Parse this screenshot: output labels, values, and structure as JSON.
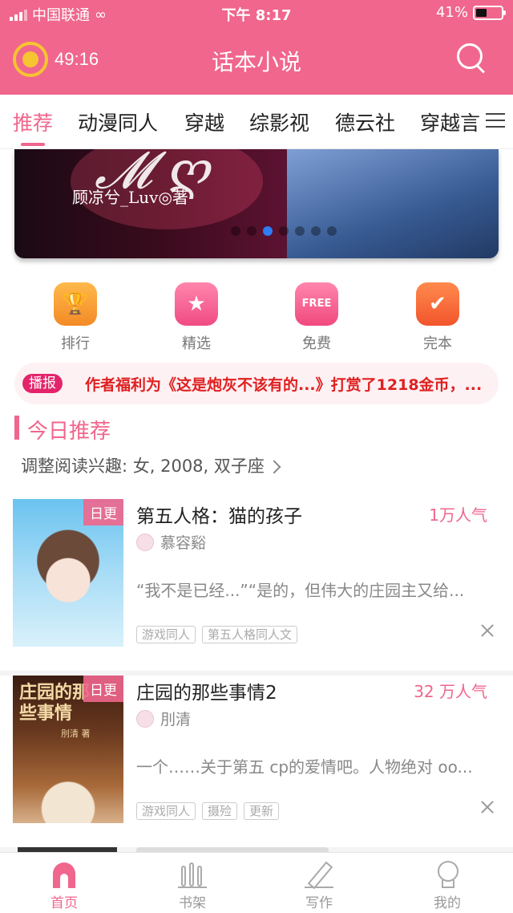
{
  "status_bar": {
    "carrier": "中国联通",
    "time": "下午 8:17",
    "battery": "41%"
  },
  "app_bar": {
    "timer": "49:16",
    "title": "话本小说"
  },
  "tabs": [
    {
      "label": "推荐",
      "active": true
    },
    {
      "label": "动漫同人"
    },
    {
      "label": "穿越"
    },
    {
      "label": "综影视"
    },
    {
      "label": "德云社"
    },
    {
      "label": "穿越言"
    }
  ],
  "banner": {
    "byline": "顾凉兮_Luv◎著",
    "slide_count": 7,
    "active_slide": 2
  },
  "quick_entries": [
    {
      "label": "排行",
      "icon": "trophy-icon",
      "color": "#f79a34"
    },
    {
      "label": "精选",
      "icon": "star-icon",
      "color": "#f25b8f"
    },
    {
      "label": "免费",
      "icon": "free-sign-icon",
      "color": "#f45f8b"
    },
    {
      "label": "完本",
      "icon": "checklist-icon",
      "color": "#f56c3c"
    }
  ],
  "notice": {
    "badge": "播报",
    "message": "作者福利为《这是炮灰不该有的...》打赏了1218金币，..."
  },
  "section": {
    "title": "今日推荐",
    "preference": "调整阅读兴趣: 女, 2008, 双子座"
  },
  "books": [
    {
      "tag": "日更",
      "title": "第五人格：猫的孩子",
      "popularity": "1万人气",
      "author": "慕容谿",
      "description": "“我不是已经...”“是的，但伟大的庄园主又给...",
      "tags": [
        "游戏同人",
        "第五人格同人文"
      ]
    },
    {
      "tag": "日更",
      "title": "庄园的那些事情2",
      "popularity": "32 万人气",
      "author": "刖清",
      "description": "一个……关于第五 cp的爱情吧。人物绝对 oo...",
      "cover_text": "庄园的那些事情",
      "cover_author": "刖清 著",
      "tags": [
        "游戏同人",
        "摄殓",
        "更新"
      ]
    }
  ],
  "bottom_nav": [
    {
      "label": "首页",
      "active": true
    },
    {
      "label": "书架"
    },
    {
      "label": "写作"
    },
    {
      "label": "我的"
    }
  ]
}
